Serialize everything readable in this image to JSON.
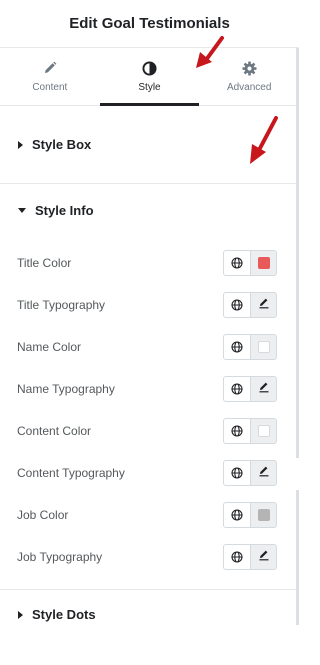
{
  "header": {
    "title": "Edit Goal Testimonials"
  },
  "tabs": [
    {
      "label": "Content",
      "icon": "pencil-icon",
      "active": false
    },
    {
      "label": "Style",
      "icon": "contrast-icon",
      "active": true
    },
    {
      "label": "Advanced",
      "icon": "gear-icon",
      "active": false
    }
  ],
  "sections": {
    "style_box": {
      "title": "Style Box",
      "expanded": false
    },
    "style_info": {
      "title": "Style Info",
      "expanded": true
    },
    "style_dots": {
      "title": "Style Dots",
      "expanded": false
    }
  },
  "controls": [
    {
      "label": "Title Color",
      "type": "color",
      "value": "#e85a5a"
    },
    {
      "label": "Title Typography",
      "type": "typography"
    },
    {
      "label": "Name Color",
      "type": "color",
      "value": "#ffffff"
    },
    {
      "label": "Name Typography",
      "type": "typography"
    },
    {
      "label": "Content Color",
      "type": "color",
      "value": "#ffffff"
    },
    {
      "label": "Content Typography",
      "type": "typography"
    },
    {
      "label": "Job Color",
      "type": "color",
      "value": "#b4b4b4"
    },
    {
      "label": "Job Typography",
      "type": "typography"
    }
  ],
  "colors": {
    "annotation_arrow": "#c8161d",
    "active_tab": "#1f2124"
  }
}
